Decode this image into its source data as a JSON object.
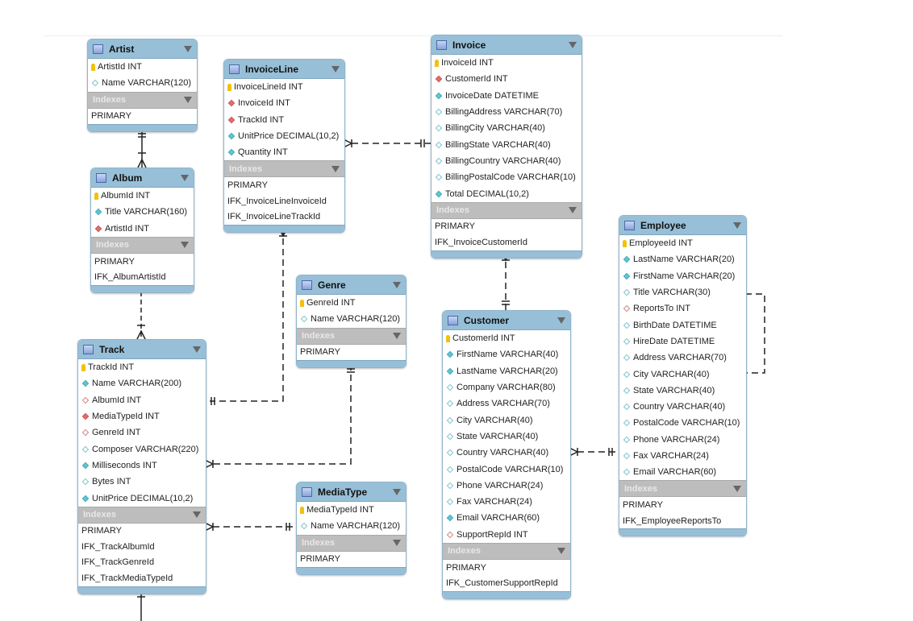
{
  "indexes_label": "Indexes",
  "colors": {
    "header": "#97bfd8",
    "indexes_bar": "#bdbdbd",
    "key": "#f2c10f",
    "fk": "#e07070",
    "column": "#5cc8d4"
  },
  "tables": [
    {
      "name": "Artist",
      "fields": [
        {
          "text": "ArtistId INT",
          "icon": "key"
        },
        {
          "text": "Name VARCHAR(120)",
          "icon": "hollow-blue"
        }
      ],
      "indexes": [
        "PRIMARY"
      ]
    },
    {
      "name": "InvoiceLine",
      "fields": [
        {
          "text": "InvoiceLineId INT",
          "icon": "key"
        },
        {
          "text": "InvoiceId INT",
          "icon": "filled-red"
        },
        {
          "text": "TrackId INT",
          "icon": "filled-red"
        },
        {
          "text": "UnitPrice DECIMAL(10,2)",
          "icon": "filled-blue"
        },
        {
          "text": "Quantity INT",
          "icon": "filled-blue"
        }
      ],
      "indexes": [
        "PRIMARY",
        "IFK_InvoiceLineInvoiceId",
        "IFK_InvoiceLineTrackId"
      ]
    },
    {
      "name": "Invoice",
      "fields": [
        {
          "text": "InvoiceId INT",
          "icon": "key"
        },
        {
          "text": "CustomerId INT",
          "icon": "filled-red"
        },
        {
          "text": "InvoiceDate DATETIME",
          "icon": "filled-blue"
        },
        {
          "text": "BillingAddress VARCHAR(70)",
          "icon": "hollow-blue"
        },
        {
          "text": "BillingCity VARCHAR(40)",
          "icon": "hollow-blue"
        },
        {
          "text": "BillingState VARCHAR(40)",
          "icon": "hollow-blue"
        },
        {
          "text": "BillingCountry VARCHAR(40)",
          "icon": "hollow-blue"
        },
        {
          "text": "BillingPostalCode VARCHAR(10)",
          "icon": "hollow-blue"
        },
        {
          "text": "Total DECIMAL(10,2)",
          "icon": "filled-blue"
        }
      ],
      "indexes": [
        "PRIMARY",
        "IFK_InvoiceCustomerId"
      ]
    },
    {
      "name": "Album",
      "fields": [
        {
          "text": "AlbumId INT",
          "icon": "key"
        },
        {
          "text": "Title VARCHAR(160)",
          "icon": "filled-blue"
        },
        {
          "text": "ArtistId INT",
          "icon": "filled-red"
        }
      ],
      "indexes": [
        "PRIMARY",
        "IFK_AlbumArtistId"
      ]
    },
    {
      "name": "Genre",
      "fields": [
        {
          "text": "GenreId INT",
          "icon": "key"
        },
        {
          "text": "Name VARCHAR(120)",
          "icon": "hollow-blue"
        }
      ],
      "indexes": [
        "PRIMARY"
      ]
    },
    {
      "name": "Track",
      "fields": [
        {
          "text": "TrackId INT",
          "icon": "key"
        },
        {
          "text": "Name VARCHAR(200)",
          "icon": "filled-blue"
        },
        {
          "text": "AlbumId INT",
          "icon": "hollow-red"
        },
        {
          "text": "MediaTypeId INT",
          "icon": "filled-red"
        },
        {
          "text": "GenreId INT",
          "icon": "hollow-red"
        },
        {
          "text": "Composer VARCHAR(220)",
          "icon": "hollow-blue"
        },
        {
          "text": "Milliseconds INT",
          "icon": "filled-blue"
        },
        {
          "text": "Bytes INT",
          "icon": "hollow-blue"
        },
        {
          "text": "UnitPrice DECIMAL(10,2)",
          "icon": "filled-blue"
        }
      ],
      "indexes": [
        "PRIMARY",
        "IFK_TrackAlbumId",
        "IFK_TrackGenreId",
        "IFK_TrackMediaTypeId"
      ]
    },
    {
      "name": "MediaType",
      "fields": [
        {
          "text": "MediaTypeId INT",
          "icon": "key"
        },
        {
          "text": "Name VARCHAR(120)",
          "icon": "hollow-blue"
        }
      ],
      "indexes": [
        "PRIMARY"
      ]
    },
    {
      "name": "Customer",
      "fields": [
        {
          "text": "CustomerId INT",
          "icon": "key"
        },
        {
          "text": "FirstName VARCHAR(40)",
          "icon": "filled-blue"
        },
        {
          "text": "LastName VARCHAR(20)",
          "icon": "filled-blue"
        },
        {
          "text": "Company VARCHAR(80)",
          "icon": "hollow-blue"
        },
        {
          "text": "Address VARCHAR(70)",
          "icon": "hollow-blue"
        },
        {
          "text": "City VARCHAR(40)",
          "icon": "hollow-blue"
        },
        {
          "text": "State VARCHAR(40)",
          "icon": "hollow-blue"
        },
        {
          "text": "Country VARCHAR(40)",
          "icon": "hollow-blue"
        },
        {
          "text": "PostalCode VARCHAR(10)",
          "icon": "hollow-blue"
        },
        {
          "text": "Phone VARCHAR(24)",
          "icon": "hollow-blue"
        },
        {
          "text": "Fax VARCHAR(24)",
          "icon": "hollow-blue"
        },
        {
          "text": "Email VARCHAR(60)",
          "icon": "filled-blue"
        },
        {
          "text": "SupportRepId INT",
          "icon": "hollow-red"
        }
      ],
      "indexes": [
        "PRIMARY",
        "IFK_CustomerSupportRepId"
      ]
    },
    {
      "name": "Employee",
      "fields": [
        {
          "text": "EmployeeId INT",
          "icon": "key"
        },
        {
          "text": "LastName VARCHAR(20)",
          "icon": "filled-blue"
        },
        {
          "text": "FirstName VARCHAR(20)",
          "icon": "filled-blue"
        },
        {
          "text": "Title VARCHAR(30)",
          "icon": "hollow-blue"
        },
        {
          "text": "ReportsTo INT",
          "icon": "hollow-red"
        },
        {
          "text": "BirthDate DATETIME",
          "icon": "hollow-blue"
        },
        {
          "text": "HireDate DATETIME",
          "icon": "hollow-blue"
        },
        {
          "text": "Address VARCHAR(70)",
          "icon": "hollow-blue"
        },
        {
          "text": "City VARCHAR(40)",
          "icon": "hollow-blue"
        },
        {
          "text": "State VARCHAR(40)",
          "icon": "hollow-blue"
        },
        {
          "text": "Country VARCHAR(40)",
          "icon": "hollow-blue"
        },
        {
          "text": "PostalCode VARCHAR(10)",
          "icon": "hollow-blue"
        },
        {
          "text": "Phone VARCHAR(24)",
          "icon": "hollow-blue"
        },
        {
          "text": "Fax VARCHAR(24)",
          "icon": "hollow-blue"
        },
        {
          "text": "Email VARCHAR(60)",
          "icon": "hollow-blue"
        }
      ],
      "indexes": [
        "PRIMARY",
        "IFK_EmployeeReportsTo"
      ]
    }
  ]
}
